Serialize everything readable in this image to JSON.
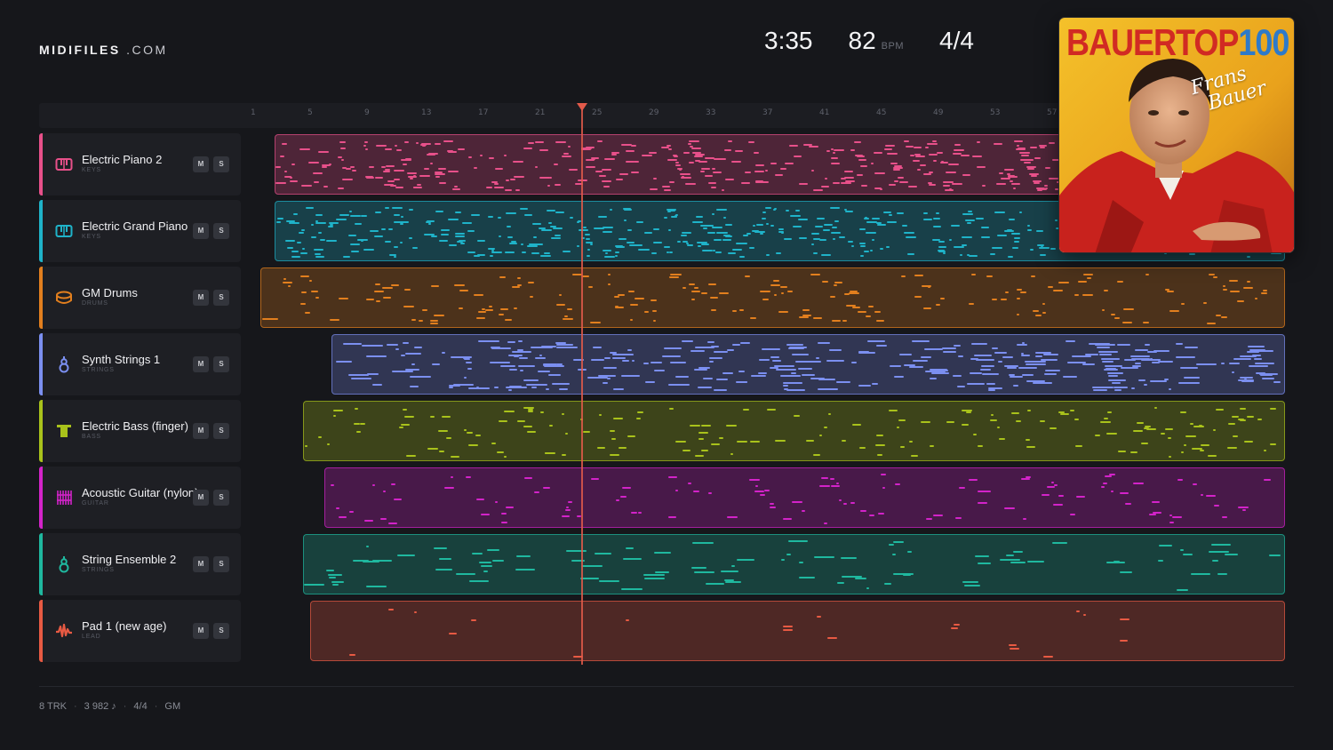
{
  "logo": {
    "brand": "MIDIFILES",
    "domain": ".COM"
  },
  "transport": {
    "time": "3:35",
    "bpm": "82",
    "bpm_unit": "BPM",
    "time_signature": "4/4"
  },
  "ruler": {
    "bars": [
      "1",
      "5",
      "9",
      "13",
      "17",
      "21",
      "25",
      "29",
      "33",
      "37",
      "41",
      "45",
      "49",
      "53",
      "57"
    ]
  },
  "playhead": {
    "bar": 25.2
  },
  "tracks": [
    {
      "name": "Electric Piano 2",
      "category": "KEYS",
      "icon": "piano-keys-icon",
      "color": "#e8508a",
      "clip_start_bar": 2.5,
      "mute": "M",
      "solo": "S"
    },
    {
      "name": "Electric Grand Piano",
      "category": "KEYS",
      "icon": "piano-keys-icon",
      "color": "#1fb3c9",
      "clip_start_bar": 2.5,
      "mute": "M",
      "solo": "S"
    },
    {
      "name": "GM Drums",
      "category": "DRUMS",
      "icon": "drum-icon",
      "color": "#e27f1e",
      "clip_start_bar": 1.5,
      "mute": "M",
      "solo": "S"
    },
    {
      "name": "Synth Strings 1",
      "category": "STRINGS",
      "icon": "violin-icon",
      "color": "#7b8ff0",
      "clip_start_bar": 6.5,
      "mute": "M",
      "solo": "S"
    },
    {
      "name": "Electric Bass (finger)",
      "category": "BASS",
      "icon": "bass-icon",
      "color": "#a9c21b",
      "clip_start_bar": 4.5,
      "mute": "M",
      "solo": "S"
    },
    {
      "name": "Acoustic Guitar (nylon)",
      "category": "GUITAR",
      "icon": "guitar-icon",
      "color": "#d323c9",
      "clip_start_bar": 6,
      "mute": "M",
      "solo": "S"
    },
    {
      "name": "String Ensemble 2",
      "category": "STRINGS",
      "icon": "violin-icon",
      "color": "#1fb89f",
      "clip_start_bar": 4.5,
      "mute": "M",
      "solo": "S"
    },
    {
      "name": "Pad 1 (new age)",
      "category": "LEAD",
      "icon": "waveform-icon",
      "color": "#e85a43",
      "clip_start_bar": 5,
      "mute": "M",
      "solo": "S"
    }
  ],
  "footer": {
    "tracks": "8 TRK",
    "notes": "3 982 ♪",
    "time_signature": "4/4",
    "standard": "GM"
  },
  "album": {
    "title_part1": "BAUER",
    "title_part2": "TOP",
    "title_part3": "100",
    "signature": "Frans Bauer"
  }
}
